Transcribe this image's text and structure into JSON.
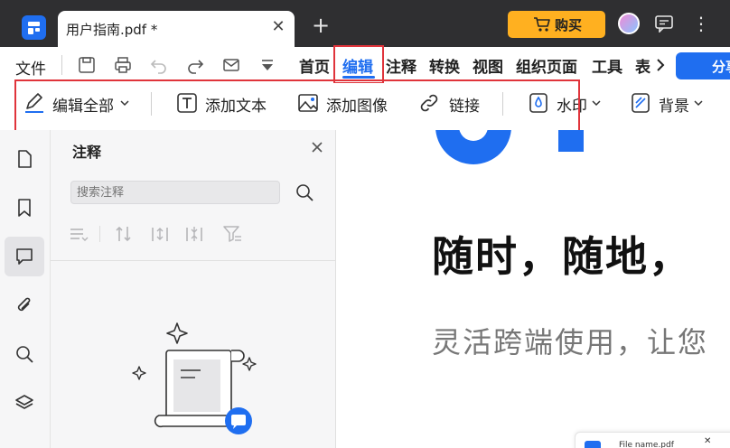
{
  "titlebar": {
    "tab_title": "用户指南.pdf *",
    "tab_close": "✕",
    "new_tab": "+",
    "buy_label": "购买",
    "more": "⋮"
  },
  "menubar": {
    "file": "文件",
    "items": [
      "首页",
      "编辑",
      "注释",
      "转换",
      "视图",
      "组织页面",
      "工具",
      "表"
    ],
    "active": "编辑",
    "share": "分享"
  },
  "toolbar": {
    "edit_all": "编辑全部",
    "add_text": "添加文本",
    "add_image": "添加图像",
    "link": "链接",
    "watermark": "水印",
    "background": "背景"
  },
  "panel": {
    "title": "注释",
    "search_placeholder": "搜索注释"
  },
  "document": {
    "heading": "随时，随地，",
    "subtitle": "灵活跨端使用，让您",
    "mini_file_name": "File name.pdf"
  },
  "colors": {
    "accent": "#1f6ef0",
    "highlight": "#e0343b",
    "buy": "#ffb020",
    "titlebar": "#2f2f31"
  }
}
